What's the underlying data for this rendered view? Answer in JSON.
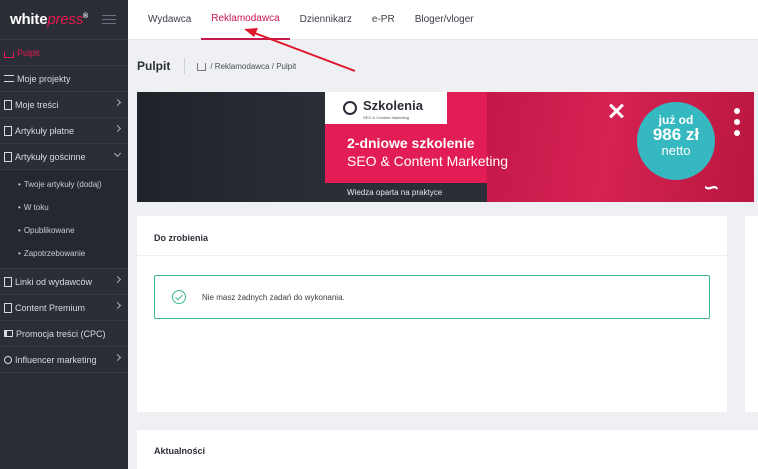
{
  "logo": {
    "part1": "white",
    "part2": "press",
    "mark": "®"
  },
  "sidebar": {
    "items": [
      {
        "label": "Pulpit",
        "icon": "home-icon"
      },
      {
        "label": "Moje projekty",
        "icon": "list-icon"
      },
      {
        "label": "Moje treści",
        "icon": "edit-icon"
      },
      {
        "label": "Artykuły płatne",
        "icon": "document-icon"
      },
      {
        "label": "Artykuły gościnne",
        "icon": "document-icon"
      },
      {
        "label": "Linki od wydawców",
        "icon": "document-icon"
      },
      {
        "label": "Content Premium",
        "icon": "edit-icon"
      },
      {
        "label": "Promocja treści (CPC)",
        "icon": "megaphone-icon"
      },
      {
        "label": "Influencer marketing",
        "icon": "people-icon"
      }
    ],
    "subitems": [
      "Twoje artykuły (dodaj)",
      "W toku",
      "Opublikowane",
      "Zapotrzebowanie"
    ]
  },
  "tabs": [
    "Wydawca",
    "Reklamodawca",
    "Dziennikarz",
    "e-PR",
    "Bloger/vloger"
  ],
  "header": {
    "title": "Pulpit",
    "breadcrumb": [
      "Reklamodawca",
      "Pulpit"
    ],
    "breadcrumb_sep": "/"
  },
  "banner": {
    "logo_title": "Szkolenia",
    "logo_sub": "SEO & Content Marketing",
    "headline": "2-dniowe szkolenie",
    "subline": "SEO & Content Marketing",
    "footer": "Wiedza oparta na praktyce",
    "price_prefix": "już od",
    "price": "986 zł",
    "price_suffix": "netto"
  },
  "todo": {
    "title": "Do zrobienia",
    "message": "Nie masz żadnych zadań do wykonania."
  },
  "news": {
    "title": "Aktualności"
  },
  "colors": {
    "accent": "#c8174b",
    "sidebar": "#2b2e37",
    "success": "#3bb98a",
    "teal": "#36b8c0"
  }
}
